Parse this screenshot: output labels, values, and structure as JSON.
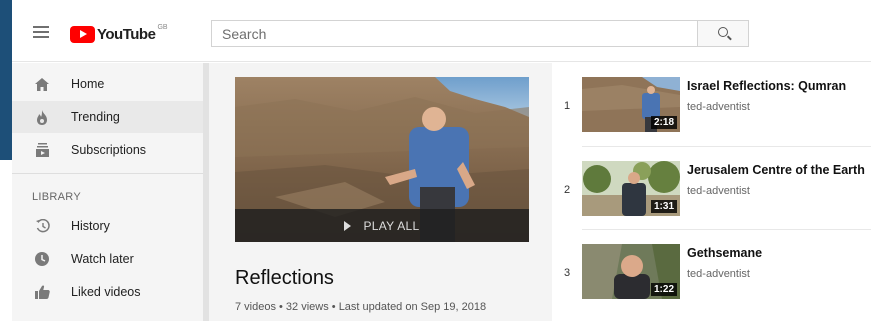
{
  "header": {
    "logo_text": "YouTube",
    "logo_region": "GB",
    "search_placeholder": "Search",
    "colors": {
      "logo_red": "#ff0000"
    }
  },
  "sidebar": {
    "items": [
      {
        "label": "Home",
        "icon": "home-icon"
      },
      {
        "label": "Trending",
        "icon": "flame-icon",
        "active": true
      },
      {
        "label": "Subscriptions",
        "icon": "subscriptions-icon"
      }
    ],
    "library_heading": "LIBRARY",
    "library_items": [
      {
        "label": "History",
        "icon": "history-icon"
      },
      {
        "label": "Watch later",
        "icon": "clock-icon"
      },
      {
        "label": "Liked videos",
        "icon": "thumbs-up-icon"
      }
    ]
  },
  "playlist": {
    "play_all_label": "PLAY ALL",
    "title": "Reflections",
    "stats": "7 videos • 32 views • Last updated on Sep 19, 2018"
  },
  "videos": [
    {
      "index": "1",
      "title": "Israel Reflections: Qumran",
      "channel": "ted-adventist",
      "duration": "2:18"
    },
    {
      "index": "2",
      "title": "Jerusalem Centre of the Earth",
      "channel": "ted-adventist",
      "duration": "1:31"
    },
    {
      "index": "3",
      "title": "Gethsemane",
      "channel": "ted-adventist",
      "duration": "1:22"
    }
  ]
}
